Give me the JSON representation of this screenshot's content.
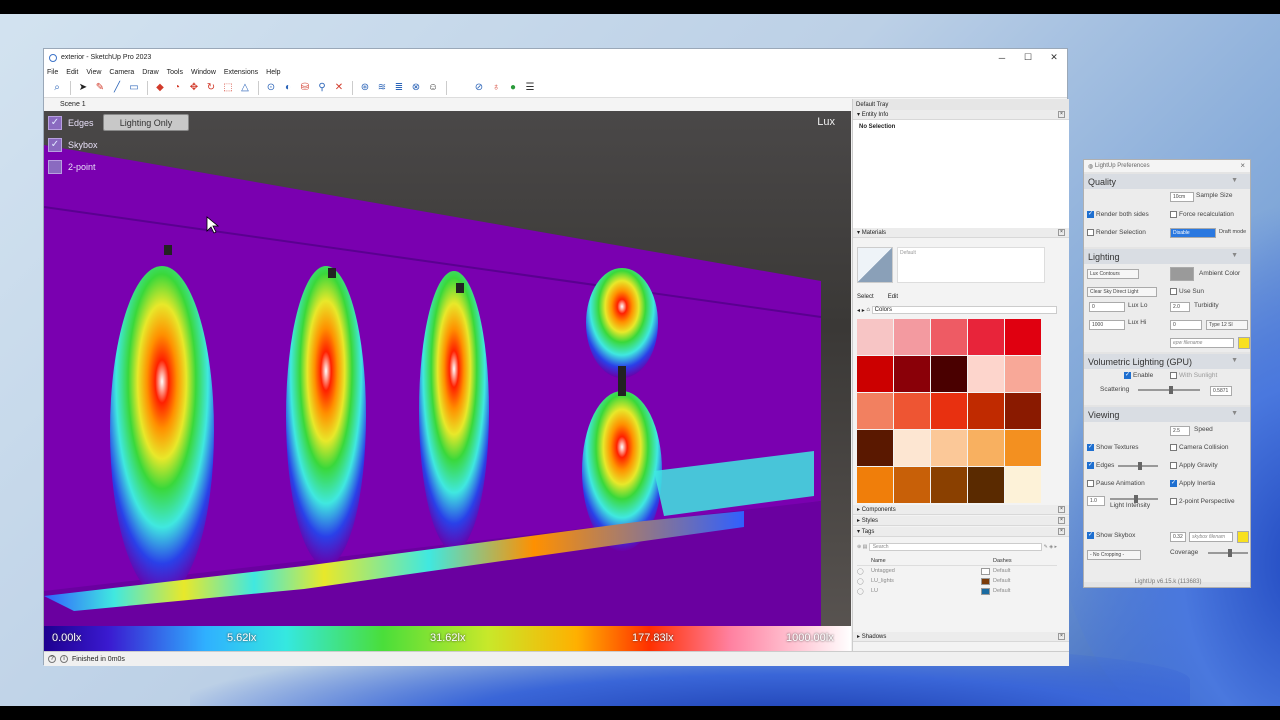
{
  "window": {
    "title": "exterior - SketchUp Pro 2023",
    "controls": [
      "─",
      "☐",
      "✕"
    ]
  },
  "menu": [
    "File",
    "Edit",
    "View",
    "Camera",
    "Draw",
    "Tools",
    "Window",
    "Extensions",
    "Help"
  ],
  "scene_tab": "Scene 1",
  "viewport": {
    "edges_label": "Edges",
    "lighting_only_label": "Lighting Only",
    "skybox_label": "Skybox",
    "two_point_label": "2-point",
    "unit_label": "Lux",
    "legend": [
      "0.00lx",
      "5.62lx",
      "31.62lx",
      "177.83lx",
      "1000.00lx"
    ]
  },
  "status": {
    "text": "Finished in 0m0s"
  },
  "tray": {
    "title": "Default Tray",
    "entity_info": "Entity Info",
    "no_selection": "No Selection",
    "materials": "Materials",
    "default_material": "Default",
    "select_tab": "Select",
    "edit_tab": "Edit",
    "colors_dropdown": "Colors",
    "swatches": [
      "#f7c5c5",
      "#f39aa0",
      "#ee5b64",
      "#e8243a",
      "#e00010",
      "#cc0000",
      "#8a0008",
      "#4a0000",
      "#fdd5cc",
      "#f8a898",
      "#f28060",
      "#ee5533",
      "#e83010",
      "#c02a00",
      "#8a1a00",
      "#5a1800",
      "#fde6d2",
      "#fbc898",
      "#f8b060",
      "#f39020",
      "#f07e0a",
      "#c86008",
      "#8a4000",
      "#5a2a00",
      "#fdf2d8"
    ],
    "components": "Components",
    "styles": "Styles",
    "tags": "Tags",
    "search_placeholder": "Search",
    "tags_headers": [
      "Name",
      "Dashes"
    ],
    "tags_rows": [
      {
        "name": "Untagged",
        "color": "#ffffff",
        "dashes": "Default"
      },
      {
        "name": "LU_lights",
        "color": "#7a3a08",
        "dashes": "Default"
      },
      {
        "name": "LU",
        "color": "#1a6aa0",
        "dashes": "Default"
      }
    ],
    "shadows": "Shadows"
  },
  "lightup": {
    "title": "LightUp Preferences",
    "quality": {
      "heading": "Quality",
      "sample_size_value": "10cm",
      "sample_size_label": "Sample Size",
      "render_both_sides": "Render both sides",
      "force_recalc": "Force recalculation",
      "render_selection": "Render Selection",
      "disable_value": "Disable",
      "draft_mode": "Draft mode"
    },
    "lighting": {
      "heading": "Lighting",
      "lux_contours": "Lux Contours",
      "ambient_color": "Ambient Color",
      "sky_type": "Clear Sky Direct Light",
      "use_sun": "Use Sun",
      "lux_lo_value": "0",
      "lux_lo_label": "Lux Lo",
      "turbidity_value": "2.0",
      "turbidity_label": "Turbidity",
      "lux_hi_value": "1000",
      "lux_hi_label": "Lux Hi",
      "type_value": "0",
      "type_sel": "Type 12 Sl",
      "epw_placeholder": "epw filename"
    },
    "volumetric": {
      "heading": "Volumetric Lighting (GPU)",
      "enable": "Enable",
      "with_sunlight": "With Sunlight",
      "scattering_label": "Scattering",
      "scattering_value": "0.5871"
    },
    "viewing": {
      "heading": "Viewing",
      "speed_value": "2.5",
      "speed_label": "Speed",
      "show_textures": "Show Textures",
      "camera_collision": "Camera Collision",
      "edges": "Edges",
      "apply_gravity": "Apply Gravity",
      "pause_animation": "Pause Animation",
      "apply_inertia": "Apply Inertia",
      "light_intensity_value": "1.0",
      "light_intensity_label": "Light Intensity",
      "two_point": "2-point Perspective",
      "show_skybox": "Show Skybox",
      "skybox_value": "0.32",
      "skybox_placeholder": "skybox filenam",
      "cropping": "- No Cropping -",
      "coverage_label": "Coverage"
    },
    "version": "LightUp v6.15.k (113683)"
  }
}
